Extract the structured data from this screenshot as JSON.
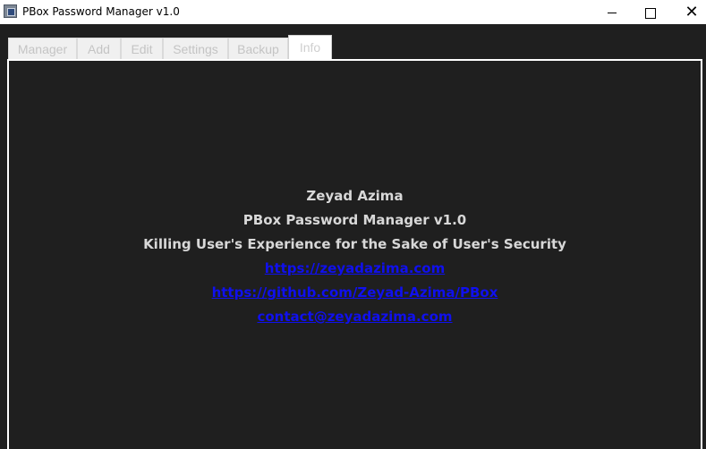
{
  "window": {
    "title": "PBox Password Manager v1.0",
    "controls": {
      "minimize": "minimize-icon",
      "maximize": "maximize-icon",
      "close": "close-icon"
    }
  },
  "tabs": [
    {
      "label": "Manager"
    },
    {
      "label": "Add"
    },
    {
      "label": "Edit"
    },
    {
      "label": "Settings"
    },
    {
      "label": "Backup"
    },
    {
      "label": "Info",
      "active": true
    }
  ],
  "info": {
    "author": "Zeyad Azima",
    "app_name": "PBox Password Manager v1.0",
    "tagline": "Killing User's Experience for the Sake of User's Security",
    "website": "https://zeyadazima.com",
    "github": "https://github.com/Zeyad-Azima/PBox",
    "email": "contact@zeyadazima.com"
  },
  "colors": {
    "background": "#1f1f1f",
    "text": "#d8d8d8",
    "link": "#1010ee"
  }
}
